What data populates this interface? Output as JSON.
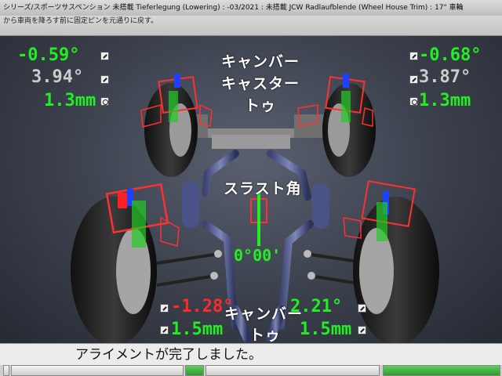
{
  "header": {
    "title": "シリーズ/スポーツサスペンション 未搭載 Tieferlegung (Lowering) : -03/2021 : 未搭載 JCW Radlaufblende (Wheel House Trim) : 17\" 車輪",
    "instruction": "から車両を降ろす前に固定ピンを元通りに戻す。"
  },
  "labels": {
    "camber": "キャンバー",
    "caster": "キャスター",
    "toe": "トゥ",
    "thrust_angle": "スラスト角",
    "rear_camber": "キャンバー",
    "rear_toe": "トゥ"
  },
  "front_left": {
    "camber": "-0.59°",
    "caster": "3.94°",
    "toe": "1.3mm"
  },
  "front_right": {
    "camber": "-0.68°",
    "caster": "3.87°",
    "toe": "1.3mm"
  },
  "thrust": {
    "value": "0°00'"
  },
  "rear_left": {
    "camber": "-1.28°",
    "toe": "1.5mm"
  },
  "rear_right": {
    "camber": "2.21°",
    "toe": "1.5mm"
  },
  "status": {
    "message": "アライメントが完了しました。"
  },
  "colors": {
    "in_spec": "#22ee22",
    "out_of_spec": "#ff2a2a",
    "neutral": "#cccccc"
  }
}
